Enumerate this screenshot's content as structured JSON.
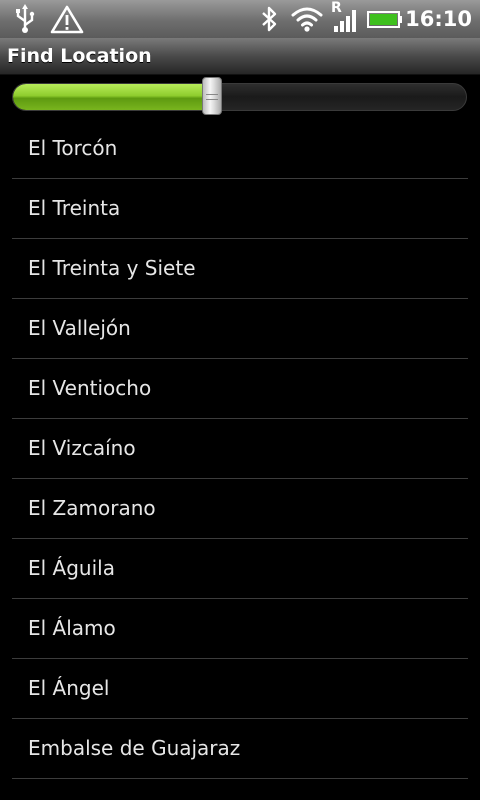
{
  "status_bar": {
    "time": "16:10",
    "icons": [
      "usb-icon",
      "warning-icon",
      "bluetooth-icon",
      "wifi-icon",
      "signal-roaming-icon",
      "battery-icon"
    ],
    "roaming_letter": "R"
  },
  "header": {
    "title": "Find Location"
  },
  "slider": {
    "level_percent": 44,
    "fill_color": "#8fcd2d"
  },
  "list": {
    "items": [
      "El Torcón",
      "El Treinta",
      "El Treinta y Siete",
      "El Vallejón",
      "El Ventiocho",
      "El Vizcaíno",
      "El Zamorano",
      "El Águila",
      "El Álamo",
      "El Ángel",
      "Embalse de Guajaraz"
    ]
  }
}
